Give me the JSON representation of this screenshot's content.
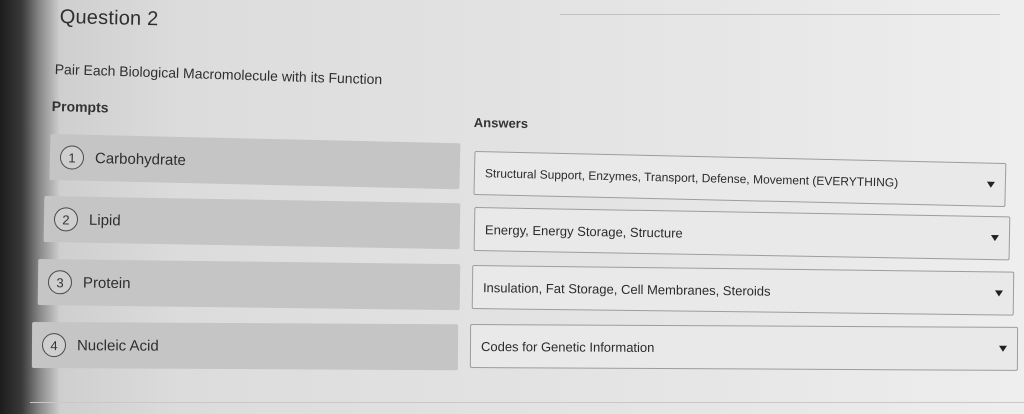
{
  "question": {
    "title": "Question 2",
    "instruction": "Pair Each Biological Macromolecule with its Function"
  },
  "headers": {
    "prompts": "Prompts",
    "answers": "Answers"
  },
  "prompts": [
    {
      "number": "1",
      "label": "Carbohydrate"
    },
    {
      "number": "2",
      "label": "Lipid"
    },
    {
      "number": "3",
      "label": "Protein"
    },
    {
      "number": "4",
      "label": "Nucleic Acid"
    }
  ],
  "answers": [
    {
      "selected": "Structural Support, Enzymes, Transport, Defense, Movement (EVERYTHING)"
    },
    {
      "selected": "Energy, Energy Storage, Structure"
    },
    {
      "selected": "Insulation, Fat Storage, Cell Membranes, Steroids"
    },
    {
      "selected": "Codes for Genetic Information"
    }
  ],
  "icons": {
    "dropdown": "caret-down-icon"
  }
}
